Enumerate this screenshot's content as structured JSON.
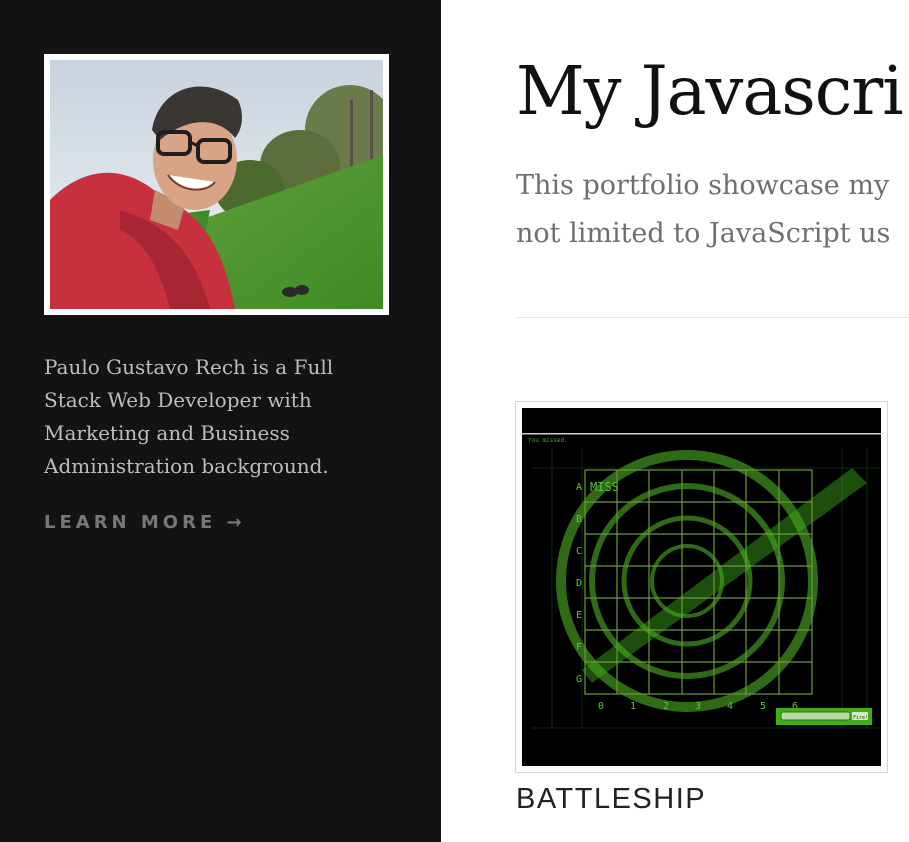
{
  "sidebar": {
    "bio": "Paulo Gustavo Rech is a Full Stack Web Developer with Marketing and Business Administration background.",
    "learn_more": "LEARN MORE →"
  },
  "main": {
    "title": "My Javascri",
    "intro": "This portfolio showcase my\nnot limited to JavaScript us",
    "projects": [
      {
        "title": "BATTLESHIP",
        "thumbnail": {
          "status": "You missed.",
          "hit_label": "MISS",
          "rows": [
            "A",
            "B",
            "C",
            "D",
            "E",
            "F",
            "G"
          ],
          "cols": [
            "0",
            "1",
            "2",
            "3",
            "4",
            "5",
            "6"
          ],
          "fire_button": "Fire!",
          "colors": {
            "background": "#000000",
            "grid": "#5e8c2a",
            "accent": "#3fae1a"
          }
        }
      }
    ]
  }
}
